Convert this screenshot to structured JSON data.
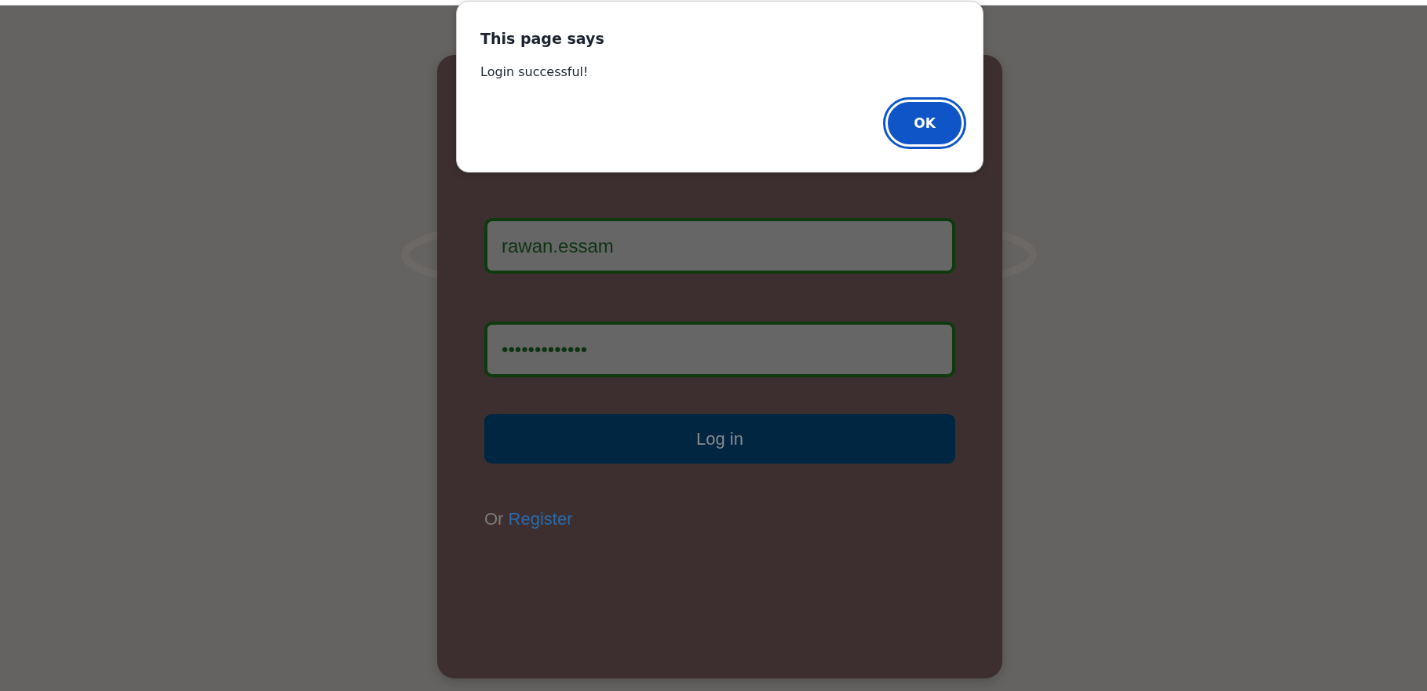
{
  "login_form": {
    "username": {
      "value": "rawan.essam"
    },
    "password": {
      "value": "•••••••••••••"
    },
    "submit_button": "Log in",
    "register_prompt": "Or",
    "register_link": "Register"
  },
  "dialog": {
    "title": "This page says",
    "message": "Login successful!",
    "buttons": [
      "OK"
    ]
  }
}
